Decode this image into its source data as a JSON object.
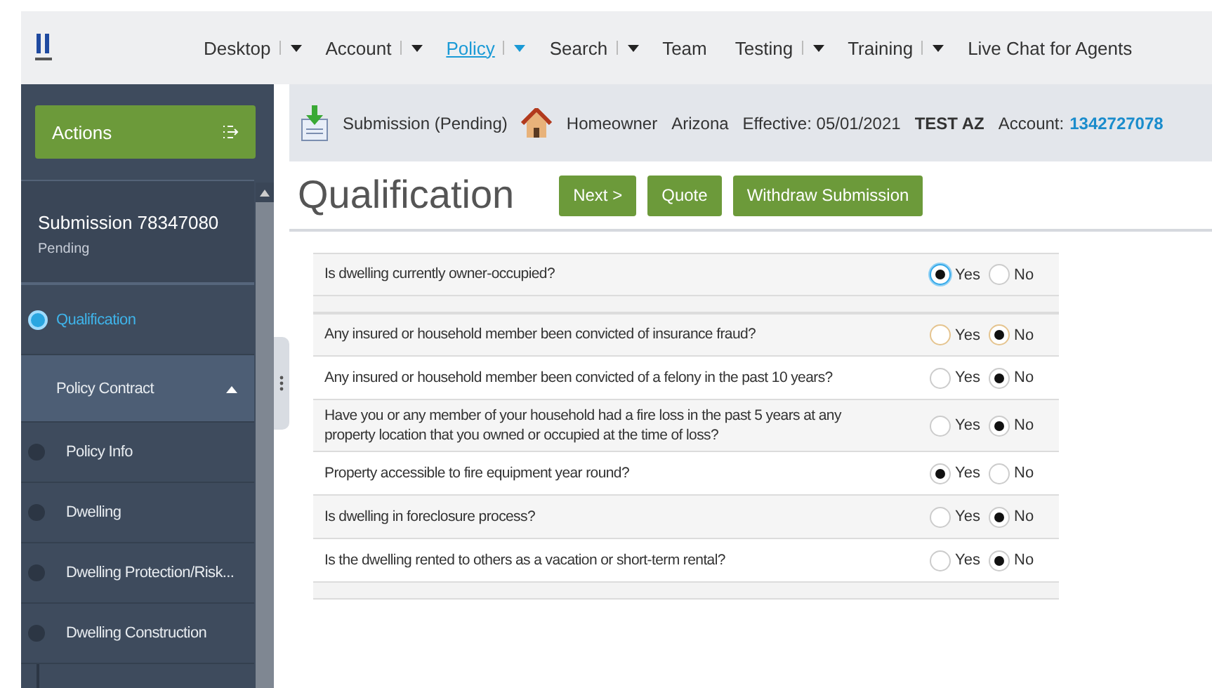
{
  "nav": {
    "items": [
      {
        "label": "Desktop",
        "dropdown": true,
        "selected": false
      },
      {
        "label": "Account",
        "dropdown": true,
        "selected": false
      },
      {
        "label": "Policy",
        "dropdown": true,
        "selected": true
      },
      {
        "label": "Search",
        "dropdown": true,
        "selected": false
      },
      {
        "label": "Team",
        "dropdown": false,
        "selected": false
      },
      {
        "label": "Testing",
        "dropdown": true,
        "selected": false
      },
      {
        "label": "Training",
        "dropdown": true,
        "selected": false
      },
      {
        "label": "Live Chat for Agents",
        "dropdown": false,
        "selected": false
      }
    ]
  },
  "sidebar": {
    "actions": "Actions",
    "submission_title": "Submission 78347080",
    "submission_status": "Pending",
    "items": [
      {
        "label": "Qualification",
        "selected": true,
        "kind": "step"
      },
      {
        "label": "Policy Contract",
        "selected": false,
        "kind": "group",
        "expanded": true,
        "children": [
          {
            "label": "Policy Info",
            "selected": false
          },
          {
            "label": "Dwelling",
            "selected": false
          },
          {
            "label": "Dwelling Protection/Risk...",
            "selected": false
          },
          {
            "label": "Dwelling Construction",
            "selected": false
          }
        ]
      }
    ]
  },
  "info_bar": {
    "status": "Submission (Pending)",
    "product": "Homeowner",
    "state": "Arizona",
    "effective": "Effective: 05/01/2021",
    "insured": "TEST AZ",
    "account_label": "Account:",
    "account_number": "1342727078"
  },
  "page": {
    "title": "Qualification",
    "buttons": [
      "Next >",
      "Quote",
      "Withdraw Submission"
    ]
  },
  "question_groups": [
    {
      "questions": [
        {
          "text": "Is dwelling currently owner-occupied?",
          "hovered": false,
          "options": [
            {
              "label": "Yes",
              "selected": true,
              "focused": true
            },
            {
              "label": "No",
              "selected": false,
              "focused": false
            }
          ]
        }
      ]
    },
    {
      "questions": [
        {
          "text": "Any insured or household member been convicted of insurance fraud?",
          "hovered": true,
          "options": [
            {
              "label": "Yes",
              "selected": false,
              "focused": false
            },
            {
              "label": "No",
              "selected": true,
              "focused": false
            }
          ]
        },
        {
          "text": "Any insured or household member been convicted of a felony in the past 10 years?",
          "hovered": false,
          "options": [
            {
              "label": "Yes",
              "selected": false,
              "focused": false
            },
            {
              "label": "No",
              "selected": true,
              "focused": false
            }
          ]
        },
        {
          "text": "Have you or any member of your household had a fire loss in the past 5 years at any property location that you owned or occupied at the time of loss?",
          "hovered": false,
          "options": [
            {
              "label": "Yes",
              "selected": false,
              "focused": false
            },
            {
              "label": "No",
              "selected": true,
              "focused": false
            }
          ]
        },
        {
          "text": "Property accessible to fire equipment year round?",
          "hovered": false,
          "options": [
            {
              "label": "Yes",
              "selected": true,
              "focused": false
            },
            {
              "label": "No",
              "selected": false,
              "focused": false
            }
          ]
        },
        {
          "text": "Is dwelling in foreclosure process?",
          "hovered": false,
          "options": [
            {
              "label": "Yes",
              "selected": false,
              "focused": false
            },
            {
              "label": "No",
              "selected": true,
              "focused": false
            }
          ]
        },
        {
          "text": "Is the dwelling rented to others as a vacation or short-term rental?",
          "hovered": false,
          "options": [
            {
              "label": "Yes",
              "selected": false,
              "focused": false
            },
            {
              "label": "No",
              "selected": true,
              "focused": false
            }
          ]
        }
      ]
    }
  ]
}
